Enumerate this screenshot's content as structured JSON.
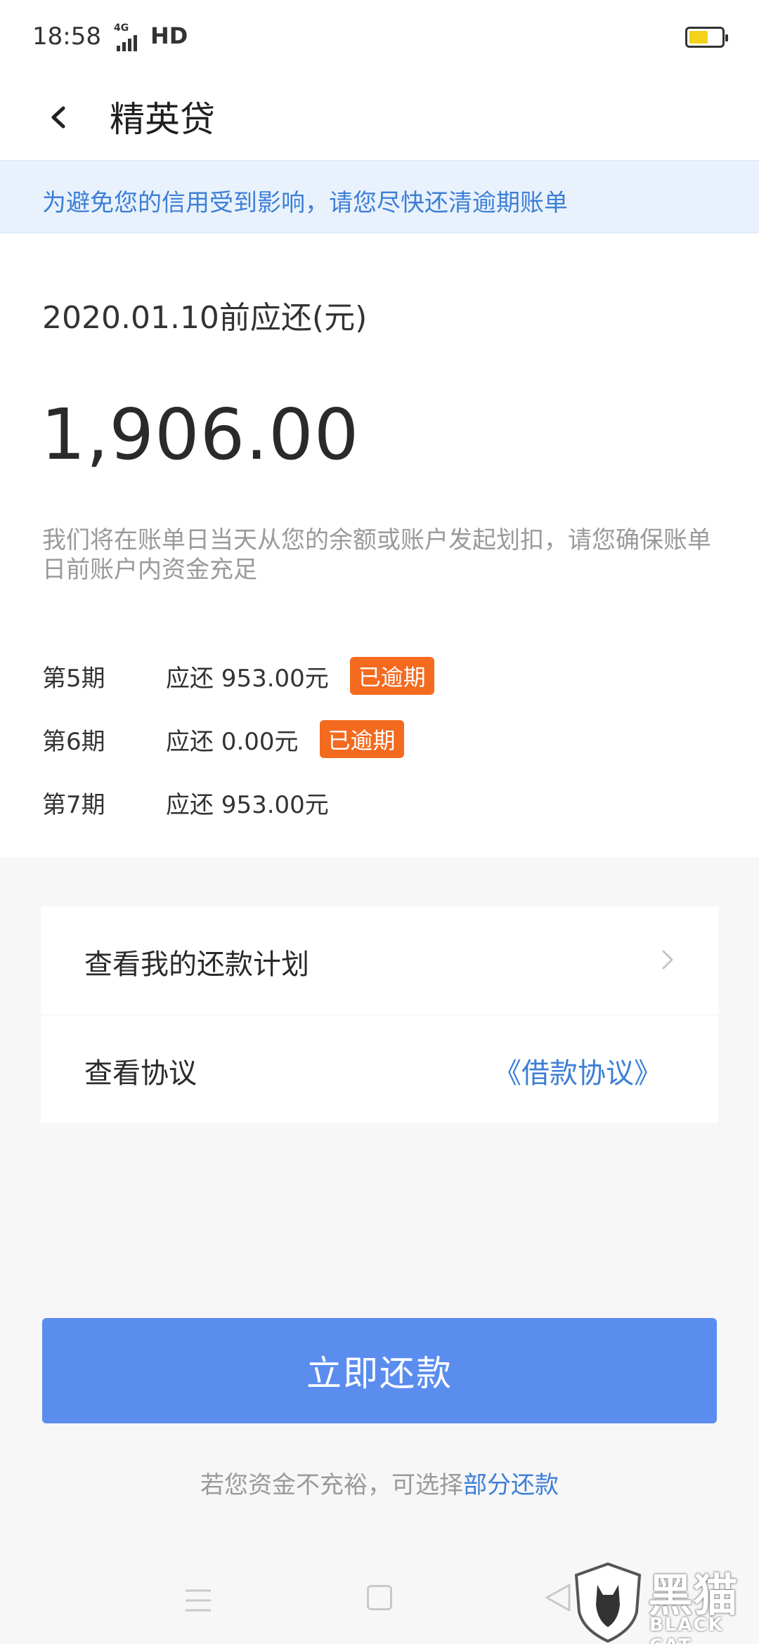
{
  "status_bar": {
    "time": "18:58",
    "network": "4G",
    "hd": "HD",
    "battery_level": 0.6,
    "battery_color": "#f2d21b"
  },
  "nav": {
    "title": "精英贷",
    "back_icon": "chevron-left-icon"
  },
  "notice": {
    "text": "为避免您的信用受到影响，请您尽快还清逾期账单",
    "color": "#3d7fd6",
    "background": "#e9f2fc"
  },
  "bill": {
    "due_label": "2020.01.10前应还(元)",
    "amount": "1,906.00",
    "note": "我们将在账单日当天从您的余额或账户发起划扣，请您确保账单日前账户内资金充足",
    "installments": [
      {
        "period": "第5期",
        "amount": "应还 953.00元",
        "badge": "已逾期"
      },
      {
        "period": "第6期",
        "amount": "应还 0.00元",
        "badge": "已逾期"
      },
      {
        "period": "第7期",
        "amount": "应还 953.00元",
        "badge": ""
      }
    ],
    "badge_color": "#f46a1f"
  },
  "links": {
    "plan_label": "查看我的还款计划",
    "agreement_label": "查看协议",
    "agreement_link": "《借款协议》"
  },
  "actions": {
    "repay_label": "立即还款",
    "repay_color": "#5b8def",
    "partial_prefix": "若您资金不充裕，可选择",
    "partial_link": "部分还款"
  },
  "system_nav": {
    "menu_icon": "menu-icon",
    "home_icon": "home-icon",
    "back_icon": "back-triangle-icon"
  },
  "watermark": {
    "cn": "黑猫",
    "en": "BLACK CAT"
  }
}
